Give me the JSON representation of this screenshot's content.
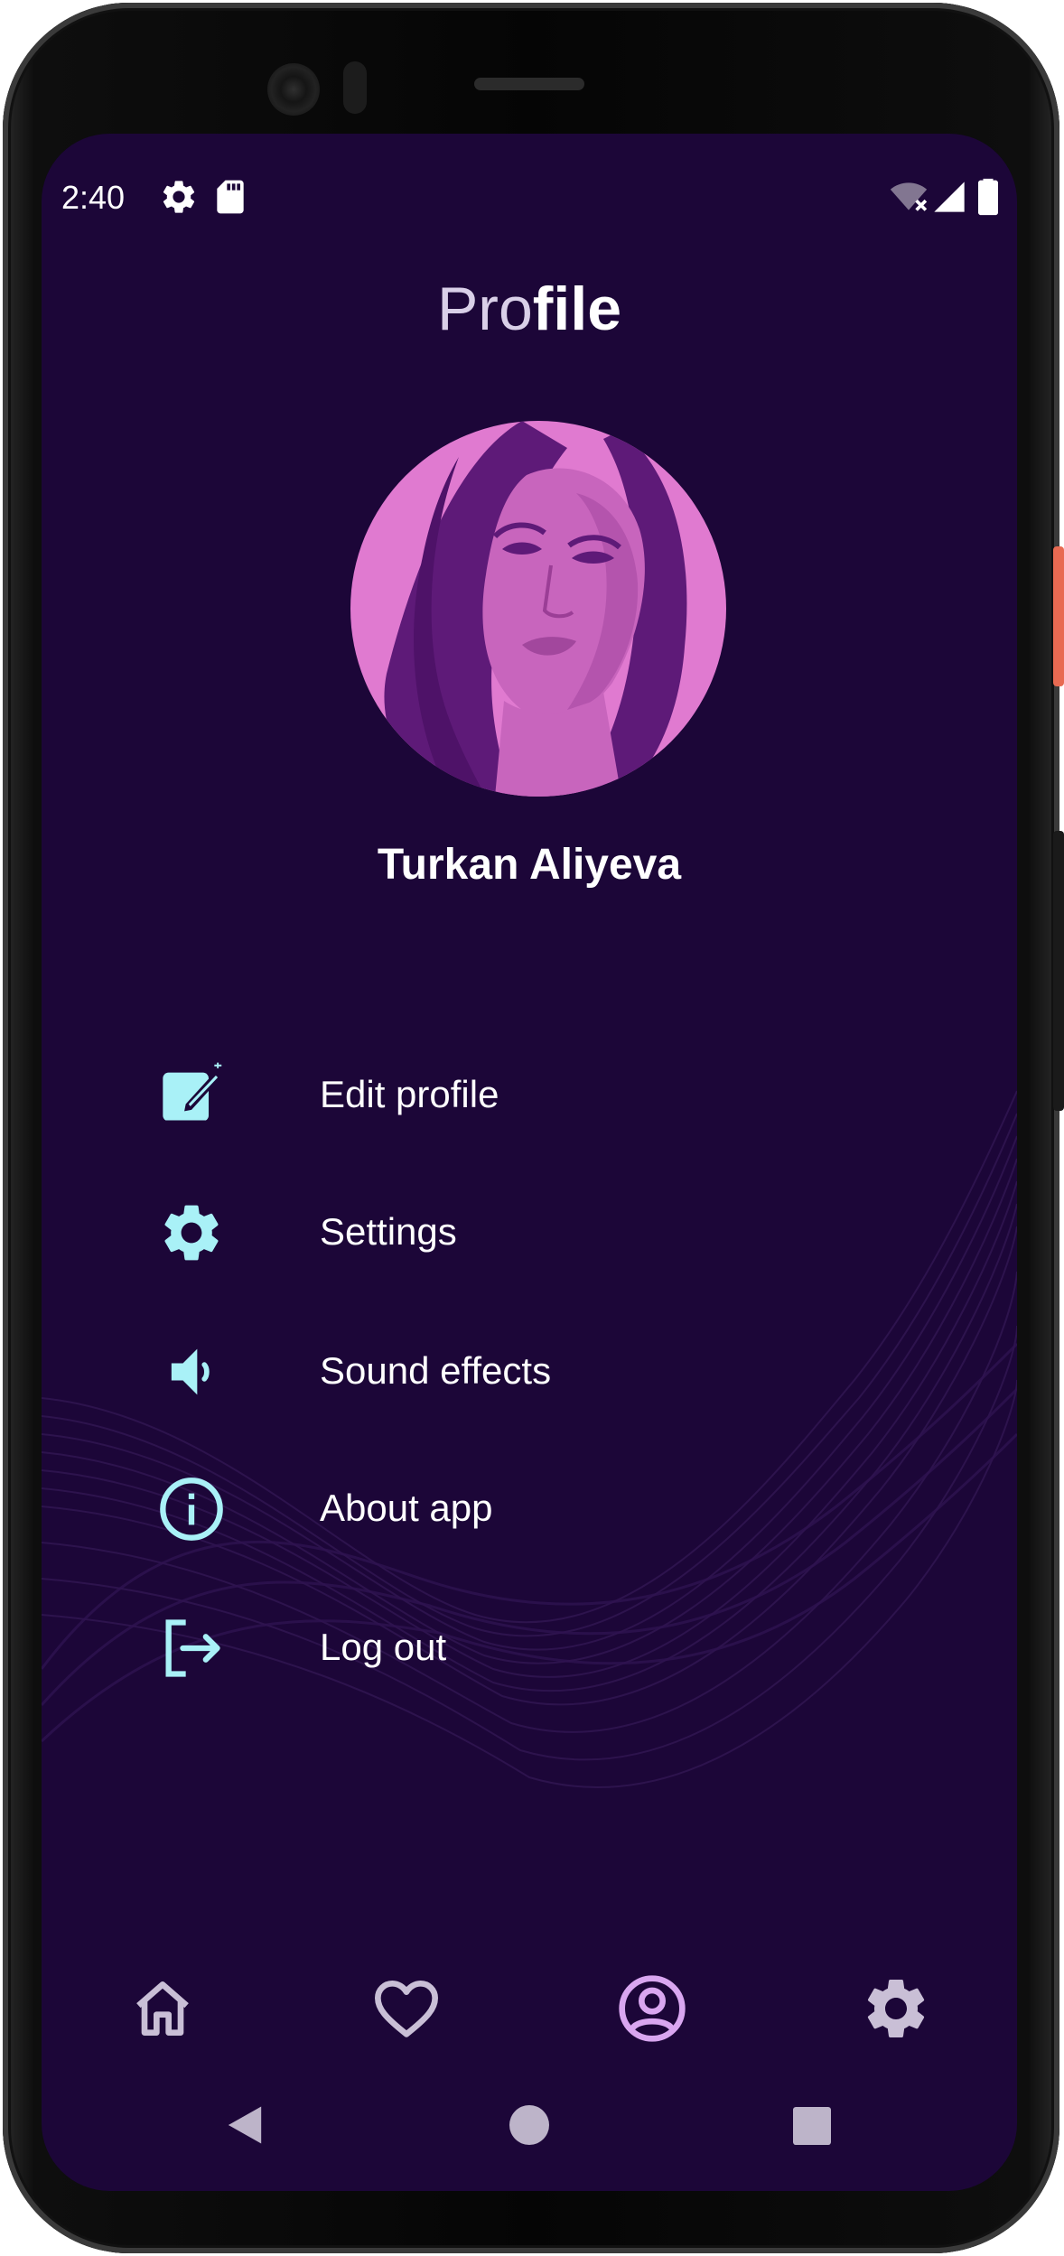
{
  "status_bar": {
    "time": "2:40",
    "left_icons": [
      "settings-icon",
      "sd-card-icon"
    ],
    "right_icons": [
      "wifi-off-icon",
      "signal-icon",
      "battery-icon"
    ]
  },
  "header": {
    "title_light": "Pro",
    "title_bold": "file"
  },
  "profile": {
    "name": "Turkan Aliyeva"
  },
  "menu": {
    "items": [
      {
        "label": "Edit profile",
        "icon": "edit-note-icon"
      },
      {
        "label": "Settings",
        "icon": "gear-icon"
      },
      {
        "label": "Sound effects",
        "icon": "speaker-icon"
      },
      {
        "label": "About app",
        "icon": "info-icon"
      },
      {
        "label": "Log out",
        "icon": "logout-icon"
      }
    ]
  },
  "bottom_nav": {
    "items": [
      {
        "icon": "home-icon"
      },
      {
        "icon": "heart-icon"
      },
      {
        "icon": "account-icon",
        "active": true
      },
      {
        "icon": "gear-icon"
      }
    ]
  },
  "system_nav": {
    "buttons": [
      "back-icon",
      "home-circle-icon",
      "recents-icon"
    ]
  },
  "colors": {
    "background": "#1c0638",
    "accent_icon": "#a9f1f7",
    "nav_icon": "#c9bfd6",
    "nav_icon_active": "#d9a6f0",
    "avatar_bg": "#e07ad0"
  }
}
